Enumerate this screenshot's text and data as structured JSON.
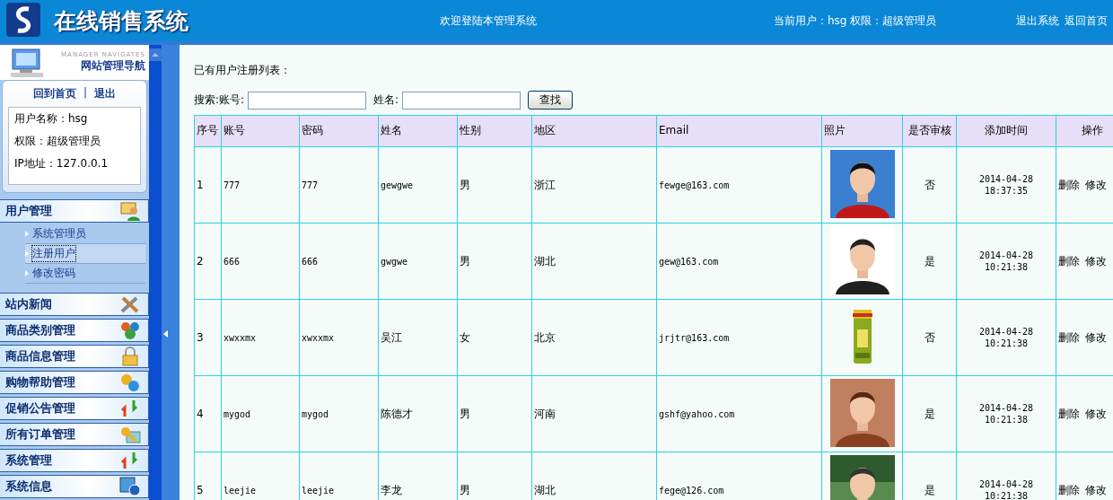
{
  "header": {
    "title": "在线销售系统",
    "welcome": "欢迎登陆本管理系统",
    "current_user": "当前用户：hsg 权限：超级管理员",
    "links": [
      "退出系统",
      "返回首页"
    ]
  },
  "sidebar": {
    "brand_en": "MANAGER NAVIGATES",
    "brand_cn": "网站管理导航",
    "links": [
      "回到首页",
      "退出"
    ],
    "separator": "|",
    "user_info": [
      "用户名称：hsg",
      "权限：超级管理员",
      "IP地址：127.0.0.1"
    ],
    "groups": [
      {
        "label": "用户管理",
        "expanded": true,
        "children": [
          {
            "label": "系统管理员",
            "selected": false
          },
          {
            "label": "注册用户",
            "selected": true
          },
          {
            "label": "修改密码",
            "selected": false
          }
        ]
      },
      {
        "label": "站内新闻",
        "expanded": false
      },
      {
        "label": "商品类别管理",
        "expanded": false
      },
      {
        "label": "商品信息管理",
        "expanded": false
      },
      {
        "label": "购物帮助管理",
        "expanded": false
      },
      {
        "label": "促销公告管理",
        "expanded": false
      },
      {
        "label": "所有订单管理",
        "expanded": false
      },
      {
        "label": "系统管理",
        "expanded": false
      },
      {
        "label": "系统信息",
        "expanded": false
      }
    ]
  },
  "main": {
    "heading": "已有用户注册列表：",
    "search": {
      "label": "搜索:账号:",
      "name_label": "姓名:",
      "button": "查找"
    },
    "table": {
      "columns": [
        "序号",
        "账号",
        "密码",
        "姓名",
        "性别",
        "地区",
        "Email",
        "照片",
        "是否审核",
        "添加时间",
        "操作"
      ],
      "rows": [
        {
          "cells": [
            "1",
            "777",
            "777",
            "gewgwe",
            "男",
            "浙江",
            "fewge@163.com"
          ],
          "approved": "否",
          "date": "2014-04-28",
          "time": "18:37:35",
          "actions": [
            "删除",
            "修改"
          ]
        },
        {
          "cells": [
            "2",
            "666",
            "666",
            "gwgwe",
            "男",
            "湖北",
            "gew@163.com"
          ],
          "approved": "是",
          "date": "2014-04-28",
          "time": "10:21:38",
          "actions": [
            "删除",
            "修改"
          ]
        },
        {
          "cells": [
            "3",
            "xwxxmx",
            "xwxxmx",
            "吴江",
            "女",
            "北京",
            "jrjtr@163.com"
          ],
          "approved": "否",
          "date": "2014-04-28",
          "time": "10:21:38",
          "actions": [
            "删除",
            "修改"
          ]
        },
        {
          "cells": [
            "4",
            "mygod",
            "mygod",
            "陈德才",
            "男",
            "河南",
            "gshf@yahoo.com"
          ],
          "approved": "是",
          "date": "2014-04-28",
          "time": "10:21:38",
          "actions": [
            "删除",
            "修改"
          ]
        },
        {
          "cells": [
            "5",
            "leejie",
            "leejie",
            "李龙",
            "男",
            "湖北",
            "fege@126.com"
          ],
          "approved": "是",
          "date": "2014-04-28",
          "time": "10:21:38",
          "actions": [
            "删除",
            "修改"
          ]
        }
      ]
    }
  }
}
